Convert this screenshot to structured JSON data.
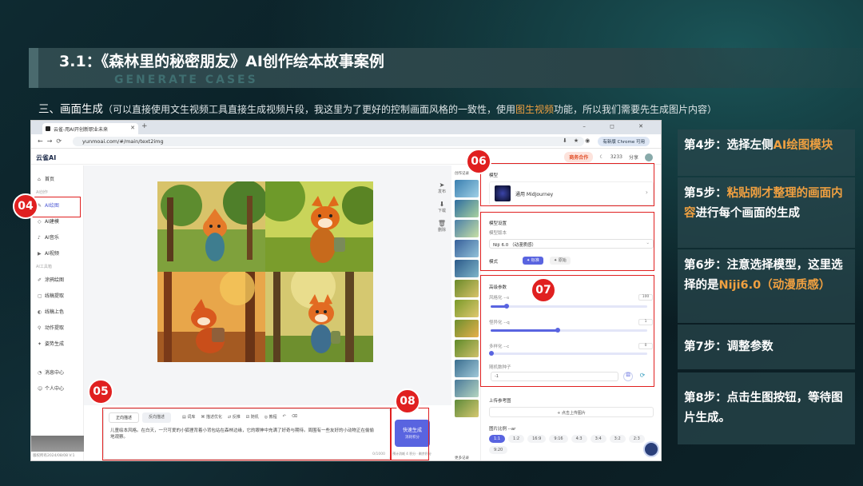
{
  "slide": {
    "title": "3.1：《森林里的秘密朋友》AI创作绘本故事案例",
    "subtitle": "GENERATE CASES",
    "section_main": "三、画面生成",
    "section_note_a": "（可以直接使用文生视频工具直接生成视频片段，我这里为了更好的控制画面风格的一致性，使用",
    "section_note_hl": "图生视频",
    "section_note_b": "功能，所以我们需要先生成图片内容）"
  },
  "browser": {
    "tab_title": "云雀-用AI开创新职业未来",
    "url": "yunmoai.com/#/main/text2img",
    "chrome_pill": "有新版 Chrome 可用",
    "window_controls": "– ◻ ✕"
  },
  "app": {
    "logo": "云雀AI",
    "coop_label": "商务合作",
    "points": "3233",
    "share": "分享"
  },
  "sidebar": {
    "home": "首页",
    "group_ai": "AI创作",
    "draw": "AI绘图",
    "model": "AI建模",
    "music": "AI音乐",
    "video": "AI视频",
    "group_tools": "AI工具箱",
    "tool1": "涂鸦绘图",
    "tool2": "线稿提取",
    "tool3": "线稿上色",
    "tool4": "动作提取",
    "tool5": "姿势生成",
    "messages": "消息中心",
    "profile": "个人中心",
    "build": "版权所有2024/08/08 V:1"
  },
  "tools": {
    "share": "发布",
    "download": "下载",
    "delete": "删除"
  },
  "history": {
    "title": "创作记录",
    "footer": "更多记录"
  },
  "panel": {
    "model_title": "模型",
    "model_name": "通用 MidJourney",
    "model_settings": "模型设置",
    "version_label": "模型版本",
    "version_value": "Niji 6.0 （动漫质感）",
    "mode_label": "模式",
    "mode_standard": "标准",
    "mode_raw": "原始",
    "advanced": "高级参数",
    "stylize_label": "风格化 --s",
    "stylize_value": "100",
    "weird_label": "怪异化 --q",
    "weird_value": "1",
    "chaos_label": "多样化 --c",
    "chaos_value": "0",
    "seed_label": "随机数种子",
    "seed_value": "-1",
    "upload_label": "上传参考图",
    "upload_btn": "+ 点击上传图片",
    "ratio_label": "图片比例 --ar",
    "ratios": [
      "1:1",
      "1:2",
      "16:9",
      "9:16",
      "4:3",
      "3:4",
      "3:2",
      "2:3",
      "9:20"
    ]
  },
  "prompt": {
    "tab_forward": "正向描述",
    "tab_reverse": "反向描述",
    "tool_words": "词库",
    "tool_describe": "描述优化",
    "tool_translate": "反推",
    "tool_random": "随机",
    "tool_tutorial": "教程",
    "text": "儿童绘本风格。在白天，一只可爱的小狐狸背着小背包站在森林边缘，它的眼神中充满了好奇与期待。周围有一些友好的小动物正在偷偷地观察。",
    "char_count": "0/1000"
  },
  "generate": {
    "label": "快速生成",
    "sub": "消耗积分",
    "foot": "预计消耗 4 积分 · 剩余积分"
  },
  "badges": [
    "04",
    "05",
    "06",
    "07",
    "08"
  ],
  "steps": [
    {
      "prefix": "第4步：选择左侧",
      "hl": "AI绘图模块",
      "suffix": ""
    },
    {
      "prefix": "第5步：",
      "hl": "粘贴刚才整理的画面内容",
      "suffix": "进行每个画面的生成"
    },
    {
      "prefix": "第6步：注意选择模型，这里选择的是",
      "hl": "Niji6.0（动漫质感）",
      "suffix": ""
    },
    {
      "prefix": "第7步：调整参数",
      "hl": "",
      "suffix": ""
    },
    {
      "prefix": "第8步：点击生图按钮，等待图片生成。",
      "hl": "",
      "suffix": ""
    }
  ],
  "colors": {
    "accent": "#f0a040",
    "annotation_red": "#e02020",
    "app_primary": "#5964e0"
  }
}
